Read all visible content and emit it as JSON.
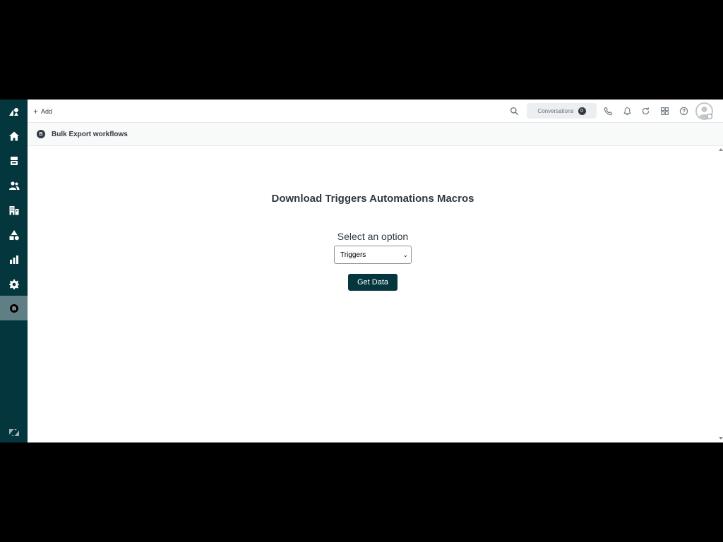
{
  "colors": {
    "sidebar": "#03363d",
    "sidebar_active": "#5f7f85",
    "primary_button": "#03363d",
    "text": "#2f3941"
  },
  "sidebar": {
    "items": [
      {
        "icon": "zendesk-logo-icon"
      },
      {
        "icon": "home-icon"
      },
      {
        "icon": "views-icon"
      },
      {
        "icon": "customers-icon"
      },
      {
        "icon": "organizations-icon"
      },
      {
        "icon": "objects-icon"
      },
      {
        "icon": "reporting-icon"
      },
      {
        "icon": "admin-gear-icon"
      },
      {
        "icon": "bulk-export-app-icon",
        "active": true
      }
    ],
    "footer_icon": "zendesk-z-icon"
  },
  "topbar": {
    "add_label": "Add",
    "conversations_label": "Conversations",
    "conversations_count": "0",
    "icons": [
      "search-icon",
      "phone-icon",
      "bell-icon",
      "refresh-icon",
      "apps-grid-icon",
      "help-icon",
      "avatar"
    ]
  },
  "app_header": {
    "logo": "B",
    "title": "Bulk Export workflows"
  },
  "main": {
    "title": "Download Triggers Automations Macros",
    "select_label": "Select an option",
    "select_value": "Triggers",
    "button_label": "Get Data"
  }
}
